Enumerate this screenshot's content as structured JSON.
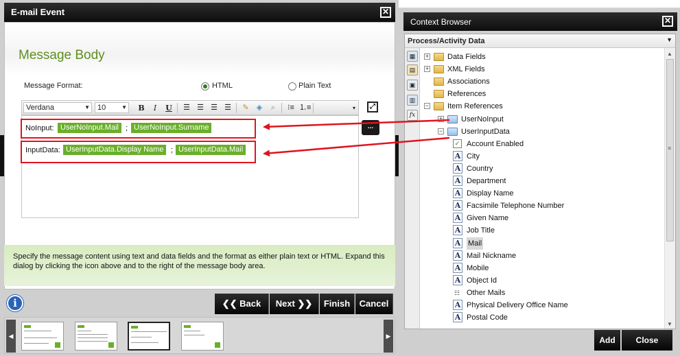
{
  "email_dialog": {
    "title": "E-mail Event",
    "heading": "Message Body",
    "format_label": "Message Format:",
    "format_options": [
      {
        "label": "HTML",
        "selected": true
      },
      {
        "label": "Plain Text",
        "selected": false
      }
    ],
    "toolbar": {
      "font": "Verdana",
      "size": "10",
      "bold": "B",
      "italic": "I",
      "underline": "U",
      "icons": [
        "align-left-icon",
        "align-center-icon",
        "align-right-icon",
        "justify-icon",
        "eraser-icon",
        "paint-icon",
        "search-icon",
        "bullet-list-icon",
        "numbered-list-icon"
      ]
    },
    "expand_icon": "expand-icon",
    "dots_label": "...",
    "rows": [
      {
        "label": "NoInput:",
        "tokens": [
          "UserNoInput.Mail",
          "UserNoInput.Surname"
        ],
        "separator": ";"
      },
      {
        "label": "InputData:",
        "tokens": [
          "UserInputData.Display Name",
          "UserInputData.Mail"
        ],
        "separator": ";"
      }
    ],
    "help_text": "Specify the message content using text and data fields and the format as either plain text or HTML. Expand this dialog by clicking the icon above and to the right of the message body area.",
    "nav": {
      "back": "Back",
      "next": "Next",
      "finish": "Finish",
      "cancel": "Cancel"
    },
    "annotation_color": "#e0141e",
    "token_color": "#6aaf2b",
    "heading_color": "#5e8f1f"
  },
  "context_browser": {
    "title": "Context Browser",
    "dropdown": "Process/Activity Data",
    "tree": [
      {
        "label": "Data Fields",
        "icon": "folder",
        "expander": "+",
        "indent": 0
      },
      {
        "label": "XML Fields",
        "icon": "folder",
        "expander": "+",
        "indent": 0
      },
      {
        "label": "Associations",
        "icon": "folder",
        "expander": "",
        "indent": 0
      },
      {
        "label": "References",
        "icon": "folder",
        "expander": "",
        "indent": 0
      },
      {
        "label": "Item References",
        "icon": "folder",
        "expander": "-",
        "indent": 0
      },
      {
        "label": "UserNoInput",
        "icon": "folder-blue",
        "expander": "+",
        "indent": 1
      },
      {
        "label": "UserInputData",
        "icon": "folder-blue",
        "expander": "-",
        "indent": 1
      },
      {
        "label": "Account Enabled",
        "icon": "check",
        "expander": "",
        "indent": 2
      },
      {
        "label": "City",
        "icon": "A",
        "expander": "",
        "indent": 2
      },
      {
        "label": "Country",
        "icon": "A",
        "expander": "",
        "indent": 2
      },
      {
        "label": "Department",
        "icon": "A",
        "expander": "",
        "indent": 2
      },
      {
        "label": "Display Name",
        "icon": "A",
        "expander": "",
        "indent": 2
      },
      {
        "label": "Facsimile Telephone Number",
        "icon": "A",
        "expander": "",
        "indent": 2
      },
      {
        "label": "Given Name",
        "icon": "A",
        "expander": "",
        "indent": 2
      },
      {
        "label": "Job Title",
        "icon": "A",
        "expander": "",
        "indent": 2
      },
      {
        "label": "Mail",
        "icon": "A",
        "expander": "",
        "indent": 2,
        "selected": true
      },
      {
        "label": "Mail Nickname",
        "icon": "A",
        "expander": "",
        "indent": 2
      },
      {
        "label": "Mobile",
        "icon": "A",
        "expander": "",
        "indent": 2
      },
      {
        "label": "Object Id",
        "icon": "A",
        "expander": "",
        "indent": 2
      },
      {
        "label": "Other Mails",
        "icon": "list",
        "expander": "",
        "indent": 2
      },
      {
        "label": "Physical Delivery Office Name",
        "icon": "A",
        "expander": "",
        "indent": 2
      },
      {
        "label": "Postal Code",
        "icon": "A",
        "expander": "",
        "indent": 2
      }
    ],
    "buttons": {
      "add": "Add",
      "close": "Close"
    }
  }
}
